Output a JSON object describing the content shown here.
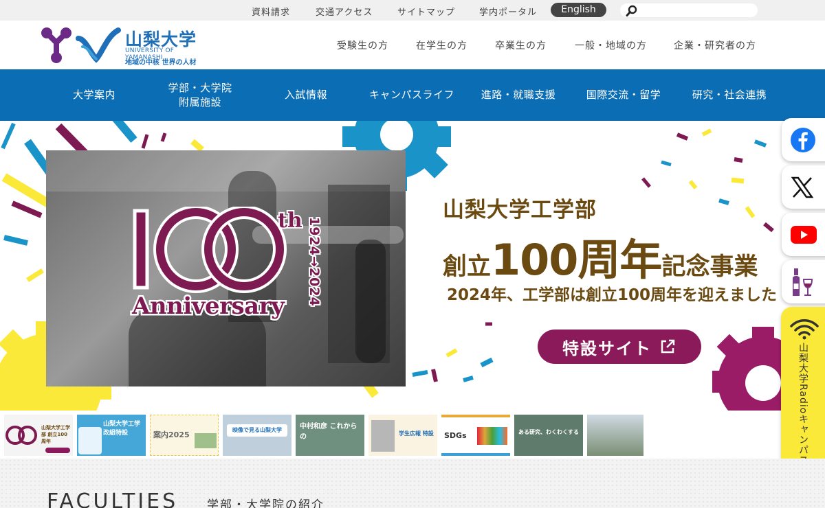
{
  "utility": {
    "links": [
      "資料請求",
      "交通アクセス",
      "サイトマップ",
      "学内ポータル"
    ],
    "english": "English",
    "search_placeholder": ""
  },
  "header": {
    "logo_name": "山梨大学",
    "logo_en": "UNIVERSITY OF YAMANASHI",
    "logo_sub": "地域の中核 世界の人材",
    "audience": [
      "受験生の方",
      "在学生の方",
      "卒業生の方",
      "一般・地域の方",
      "企業・研究者の方"
    ]
  },
  "nav": {
    "items": [
      "大学案内",
      "学部・大学院\n附属施設",
      "入試情報",
      "キャンパスライフ",
      "進路・就職支援",
      "国際交流・留学",
      "研究・社会連携"
    ]
  },
  "hero": {
    "logo_th": "th",
    "logo_years": "1924→2024",
    "logo_word": "Anniversary",
    "title1": "山梨大学工学部",
    "title2_a": "創立",
    "title2_b": "100周年",
    "title2_c": "記念事業",
    "subtitle": "2024年、工学部は創立100周年を迎えました",
    "button": "特設サイト"
  },
  "thumbs": [
    {
      "label": "山梨大学工学部 創立100周年"
    },
    {
      "label": "山梨大学工学 改組特設"
    },
    {
      "label": "案内2025"
    },
    {
      "label": "映像で見る山梨大学"
    },
    {
      "label": "中村和彦 これからの"
    },
    {
      "label": "学生広報 特設"
    },
    {
      "label": "SDGs"
    },
    {
      "label": "ある研究、わくわくする"
    },
    {
      "label": ""
    }
  ],
  "side": {
    "radio": "山梨大学Radioキャンパス"
  },
  "faculties": {
    "title_en": "FACULTIES",
    "title_jp": "学部・大学院の紹介"
  },
  "colors": {
    "nav_blue": "#0b6db3",
    "brand_purple": "#8a1a5a",
    "accent_yellow": "#fbe93a",
    "hero_brown": "#6b4a12"
  }
}
